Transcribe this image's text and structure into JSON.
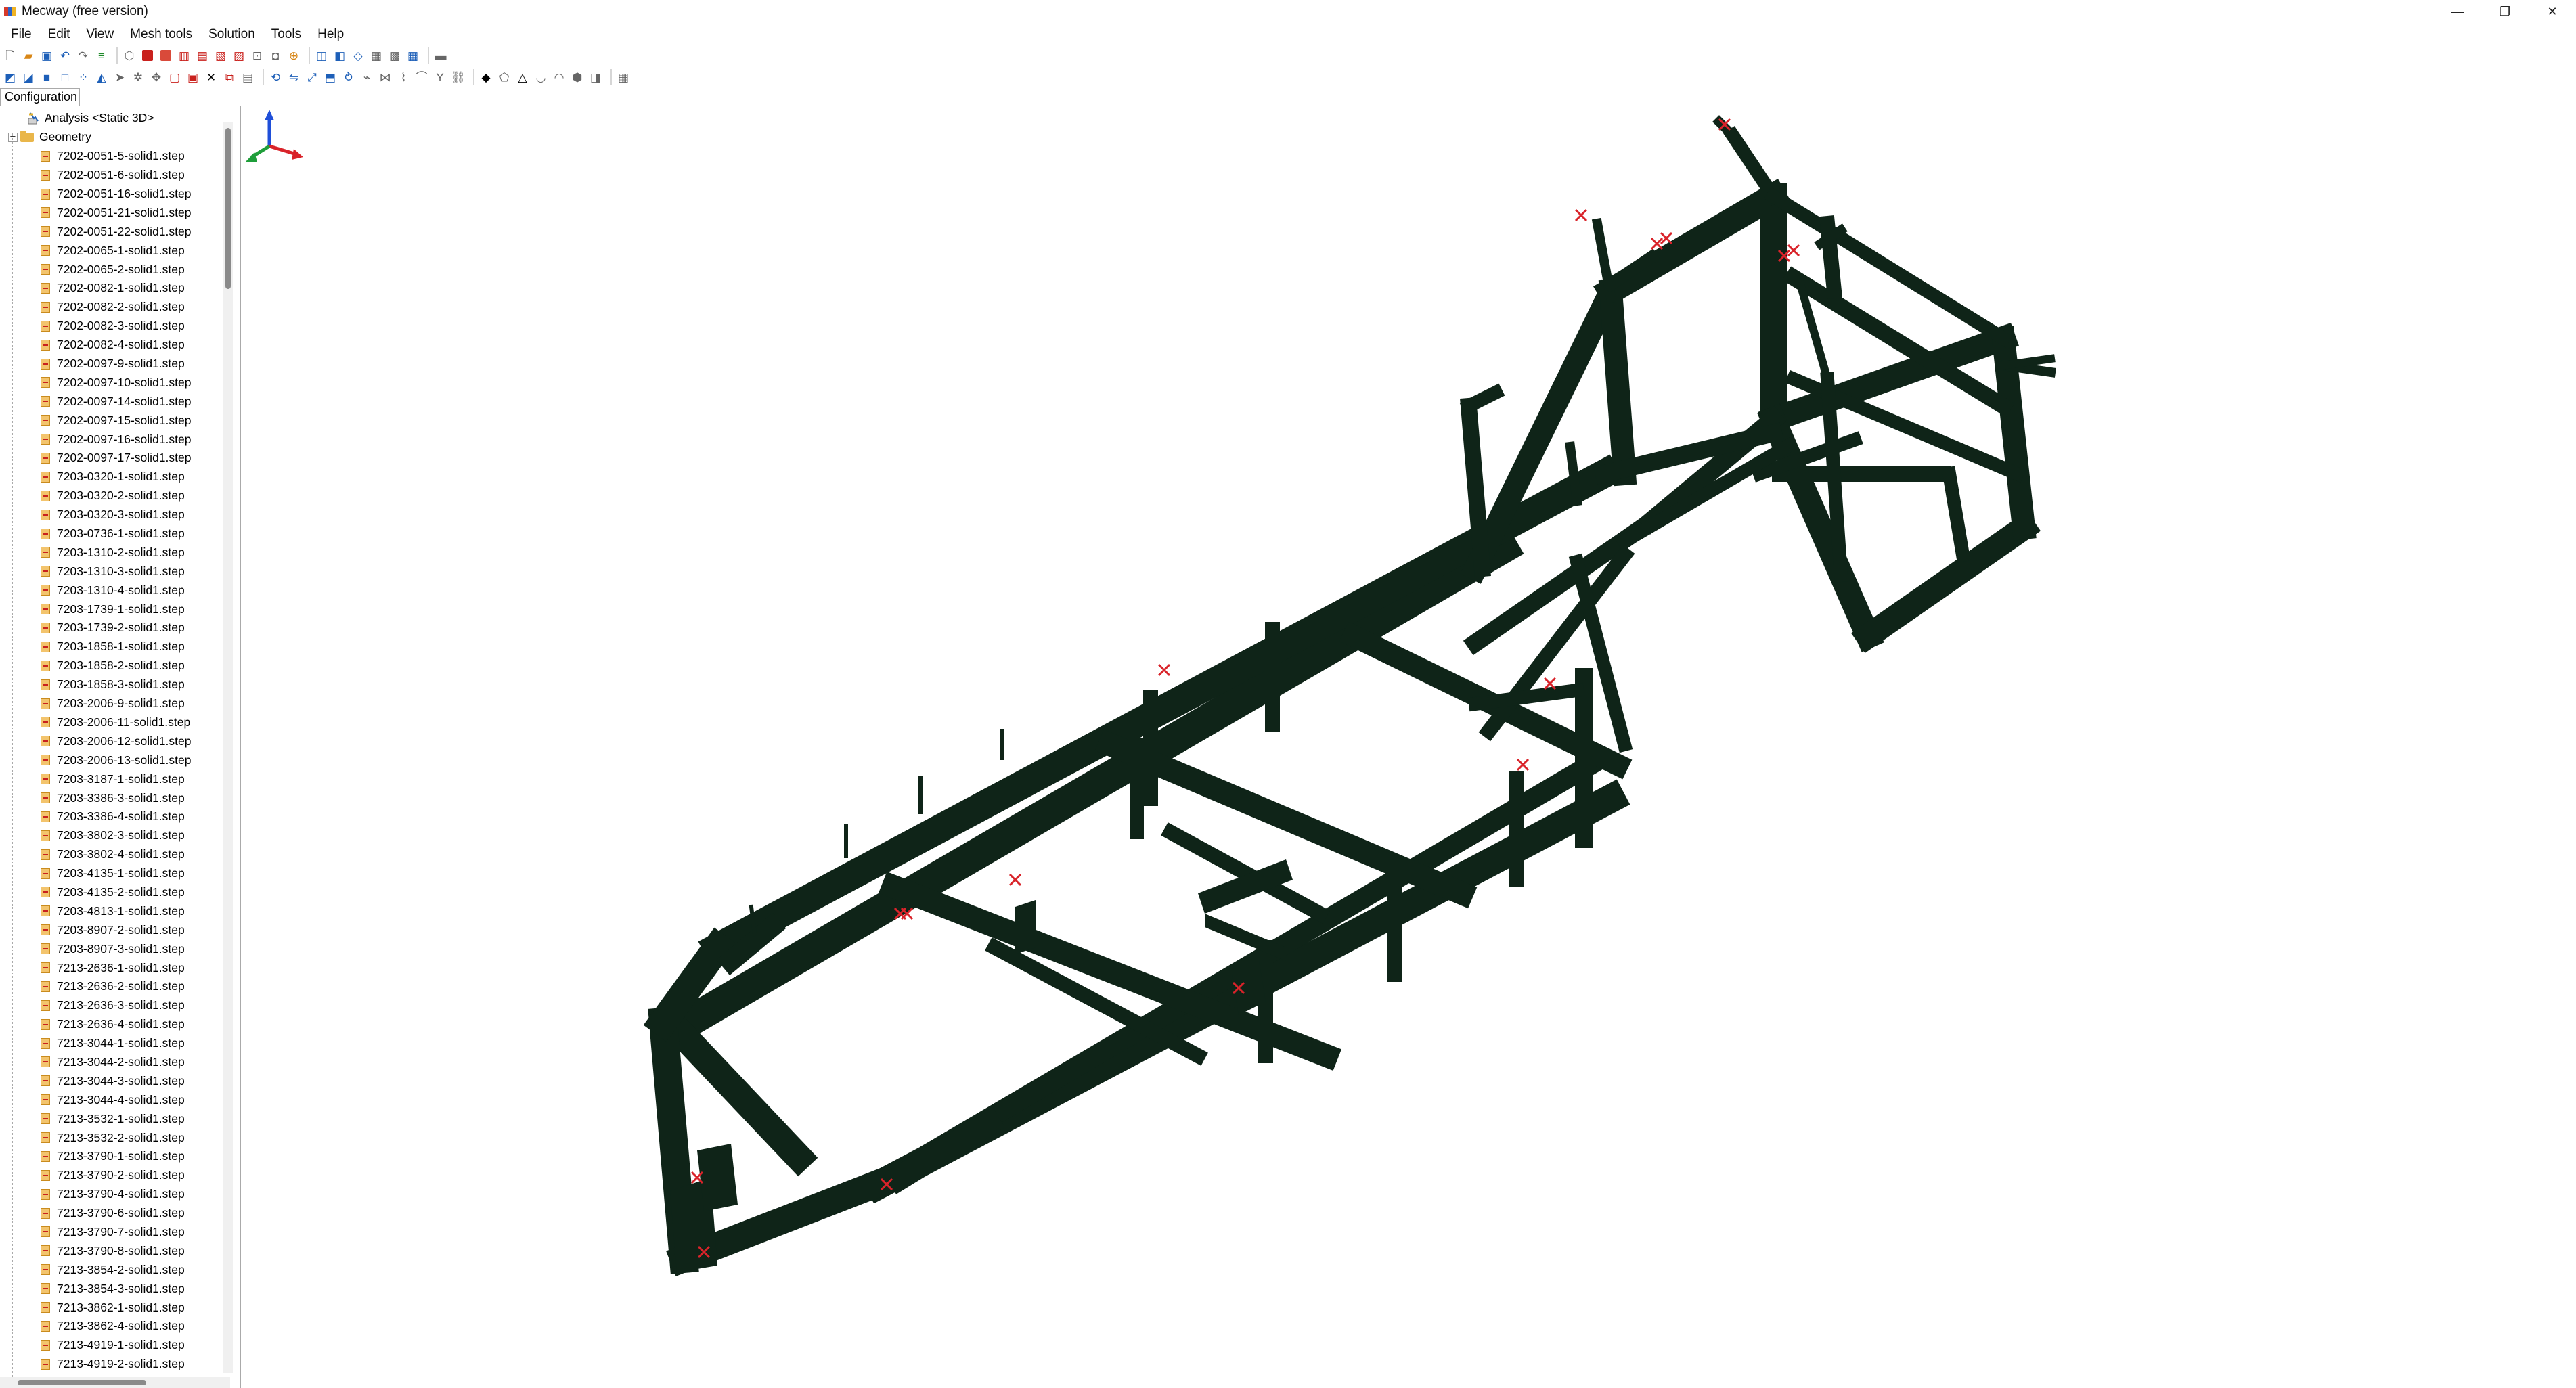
{
  "window": {
    "title": "Mecway (free version)",
    "minimize_glyph": "—",
    "restore_glyph": "❐",
    "close_glyph": "✕"
  },
  "menu": [
    "File",
    "Edit",
    "View",
    "Mesh tools",
    "Solution",
    "Tools",
    "Help"
  ],
  "panel": {
    "tab_label": "Configuration",
    "analysis_label": "Analysis <Static 3D>",
    "geometry_label": "Geometry",
    "geometry_items": [
      "7202-0051-5-solid1.step",
      "7202-0051-6-solid1.step",
      "7202-0051-16-solid1.step",
      "7202-0051-21-solid1.step",
      "7202-0051-22-solid1.step",
      "7202-0065-1-solid1.step",
      "7202-0065-2-solid1.step",
      "7202-0082-1-solid1.step",
      "7202-0082-2-solid1.step",
      "7202-0082-3-solid1.step",
      "7202-0082-4-solid1.step",
      "7202-0097-9-solid1.step",
      "7202-0097-10-solid1.step",
      "7202-0097-14-solid1.step",
      "7202-0097-15-solid1.step",
      "7202-0097-16-solid1.step",
      "7202-0097-17-solid1.step",
      "7203-0320-1-solid1.step",
      "7203-0320-2-solid1.step",
      "7203-0320-3-solid1.step",
      "7203-0736-1-solid1.step",
      "7203-1310-2-solid1.step",
      "7203-1310-3-solid1.step",
      "7203-1310-4-solid1.step",
      "7203-1739-1-solid1.step",
      "7203-1739-2-solid1.step",
      "7203-1858-1-solid1.step",
      "7203-1858-2-solid1.step",
      "7203-1858-3-solid1.step",
      "7203-2006-9-solid1.step",
      "7203-2006-11-solid1.step",
      "7203-2006-12-solid1.step",
      "7203-2006-13-solid1.step",
      "7203-3187-1-solid1.step",
      "7203-3386-3-solid1.step",
      "7203-3386-4-solid1.step",
      "7203-3802-3-solid1.step",
      "7203-3802-4-solid1.step",
      "7203-4135-1-solid1.step",
      "7203-4135-2-solid1.step",
      "7203-4813-1-solid1.step",
      "7203-8907-2-solid1.step",
      "7203-8907-3-solid1.step",
      "7213-2636-1-solid1.step",
      "7213-2636-2-solid1.step",
      "7213-2636-3-solid1.step",
      "7213-2636-4-solid1.step",
      "7213-3044-1-solid1.step",
      "7213-3044-2-solid1.step",
      "7213-3044-3-solid1.step",
      "7213-3044-4-solid1.step",
      "7213-3532-1-solid1.step",
      "7213-3532-2-solid1.step",
      "7213-3790-1-solid1.step",
      "7213-3790-2-solid1.step",
      "7213-3790-4-solid1.step",
      "7213-3790-6-solid1.step",
      "7213-3790-7-solid1.step",
      "7213-3790-8-solid1.step",
      "7213-3854-2-solid1.step",
      "7213-3854-3-solid1.step",
      "7213-3862-1-solid1.step",
      "7213-3862-4-solid1.step",
      "7213-4919-1-solid1.step",
      "7213-4919-2-solid1.step"
    ]
  },
  "viewport": {
    "mesh_color": "#0f2418",
    "constraint_color": "#d9232a",
    "triad": {
      "x_color": "#d9232a",
      "y_color": "#1f9e3a",
      "z_color": "#1f4fd9"
    }
  },
  "icons": {
    "toolbar_row1": [
      "new-file-icon",
      "open-folder-icon",
      "save-icon",
      "undo-icon",
      "redo-icon",
      "toggle-icon",
      "view-iso-icon",
      "solid-red-icon",
      "solid-red-2-icon",
      "view-front-icon",
      "view-top-icon",
      "view-side-icon",
      "view-back-icon",
      "zoom-fit-icon",
      "camera-icon",
      "select-icon",
      "select-box-icon",
      "shade-icon",
      "wireframe-icon",
      "mesh-icon",
      "grid-icon",
      "dash-icon"
    ],
    "toolbar_row2": [
      "cube-blue-icon",
      "cube-blue-2-icon",
      "cube-blue-3-icon",
      "cube-outline-icon",
      "node-icon",
      "element-icon",
      "arrow-icon",
      "gear-icon",
      "box-red-icon",
      "square-red-icon",
      "delete-icon",
      "copy-icon",
      "move-icon",
      "rotate-icon",
      "mirror-icon",
      "scale-icon",
      "extrude-icon",
      "revolve-icon",
      "sweep-icon",
      "merge-icon",
      "split-icon",
      "measure-icon",
      "triangle-icon",
      "rounding-icon",
      "shell-icon",
      "hex-icon",
      "table-icon"
    ]
  }
}
